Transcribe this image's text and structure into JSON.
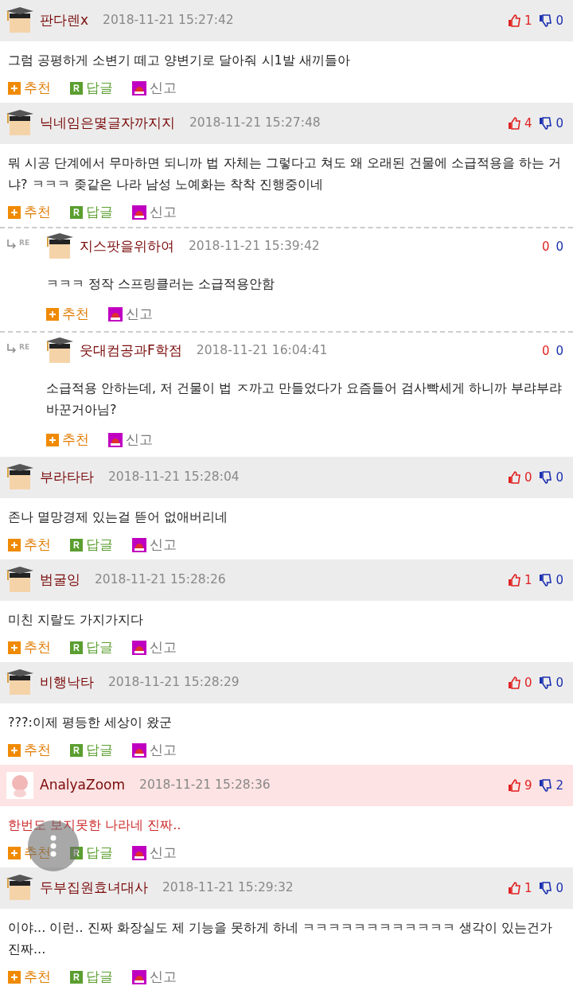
{
  "comments": [
    {
      "kind": "comment",
      "avatar": {
        "kind": "default"
      },
      "highlighted": false,
      "author": "판다렌x",
      "date": "2018-11-21 15:27:42",
      "likes": "1",
      "dislikes": "0",
      "text": "그럼 공평하게 소변기 떼고 양변기로 달아줘 시1발 새끼들아",
      "actions": [
        {
          "kind": "recommend",
          "label": "추천"
        },
        {
          "kind": "reply",
          "label": "답글"
        },
        {
          "kind": "report",
          "label": "신고"
        }
      ]
    },
    {
      "kind": "comment",
      "avatar": {
        "kind": "default"
      },
      "highlighted": false,
      "author": "닉네임은몇글자까지지",
      "date": "2018-11-21 15:27:48",
      "likes": "4",
      "dislikes": "0",
      "text": "뭐 시공 단계에서 무마하면 되니까 법 자체는 그렇다고 쳐도 왜 오래된 건물에 소급적용을 하는 거냐? ㅋㅋㅋ 좆같은 나라 남성 노예화는 착착 진행중이네",
      "actions": [
        {
          "kind": "recommend",
          "label": "추천"
        },
        {
          "kind": "reply",
          "label": "답글"
        },
        {
          "kind": "report",
          "label": "신고"
        }
      ]
    },
    {
      "kind": "reply",
      "re_label": "RE",
      "avatar": {
        "kind": "default"
      },
      "highlighted": false,
      "author": "지스팟을위하여",
      "date": "2018-11-21 15:39:42",
      "likes": "0",
      "dislikes": "0",
      "text": "ㅋㅋㅋ 정작 스프링클러는 소급적용안함",
      "actions": [
        {
          "kind": "recommend",
          "label": "추천"
        },
        {
          "kind": "report",
          "label": "신고"
        }
      ]
    },
    {
      "kind": "reply",
      "re_label": "RE",
      "avatar": {
        "kind": "default"
      },
      "highlighted": false,
      "author": "웃대컴공과F학점",
      "date": "2018-11-21 16:04:41",
      "likes": "0",
      "dislikes": "0",
      "text": "소급적용 안하는데, 저 건물이 법 ㅈ까고 만들었다가 요즘들어 검사빡세게 하니까 부랴부랴 바꾼거아님?",
      "actions": [
        {
          "kind": "recommend",
          "label": "추천"
        },
        {
          "kind": "report",
          "label": "신고"
        }
      ]
    },
    {
      "kind": "comment",
      "avatar": {
        "kind": "default"
      },
      "highlighted": false,
      "author": "부라타타",
      "date": "2018-11-21 15:28:04",
      "likes": "0",
      "dislikes": "0",
      "text": "존나 멸망경제 있는걸 뜯어 없애버리네",
      "actions": [
        {
          "kind": "recommend",
          "label": "추천"
        },
        {
          "kind": "reply",
          "label": "답글"
        },
        {
          "kind": "report",
          "label": "신고"
        }
      ]
    },
    {
      "kind": "comment",
      "avatar": {
        "kind": "default"
      },
      "highlighted": false,
      "author": "범굴잉",
      "date": "2018-11-21 15:28:26",
      "likes": "1",
      "dislikes": "0",
      "text": "미친 지랄도 가지가지다",
      "actions": [
        {
          "kind": "recommend",
          "label": "추천"
        },
        {
          "kind": "reply",
          "label": "답글"
        },
        {
          "kind": "report",
          "label": "신고"
        }
      ]
    },
    {
      "kind": "comment",
      "avatar": {
        "kind": "default"
      },
      "highlighted": false,
      "author": "비행낙타",
      "date": "2018-11-21 15:28:29",
      "likes": "0",
      "dislikes": "0",
      "text": "???:이제 평등한 세상이 왔군",
      "actions": [
        {
          "kind": "recommend",
          "label": "추천"
        },
        {
          "kind": "reply",
          "label": "답글"
        },
        {
          "kind": "report",
          "label": "신고"
        }
      ]
    },
    {
      "kind": "comment",
      "avatar": {
        "kind": "custom"
      },
      "highlighted": true,
      "author": "AnalyaZoom",
      "date": "2018-11-21 15:28:36",
      "likes": "9",
      "dislikes": "2",
      "text": "한번도 보지못한 나라네 진짜..",
      "actions": [
        {
          "kind": "recommend",
          "label": "추천"
        },
        {
          "kind": "reply",
          "label": "답글"
        },
        {
          "kind": "report",
          "label": "신고"
        }
      ]
    },
    {
      "kind": "comment",
      "avatar": {
        "kind": "default"
      },
      "highlighted": false,
      "author": "두부집원효녀대사",
      "date": "2018-11-21 15:29:32",
      "likes": "1",
      "dislikes": "0",
      "text": "이야... 이런.. 진짜 화장실도 제 기능을 못하게 하네 ㅋㅋㅋㅋㅋㅋㅋㅋㅋㅋㅋㅋ 생각이 있는건가 진짜...",
      "actions": [
        {
          "kind": "recommend",
          "label": "추천"
        },
        {
          "kind": "reply",
          "label": "답글"
        },
        {
          "kind": "report",
          "label": "신고"
        }
      ]
    }
  ],
  "floating_button": {
    "kind": "menu"
  }
}
